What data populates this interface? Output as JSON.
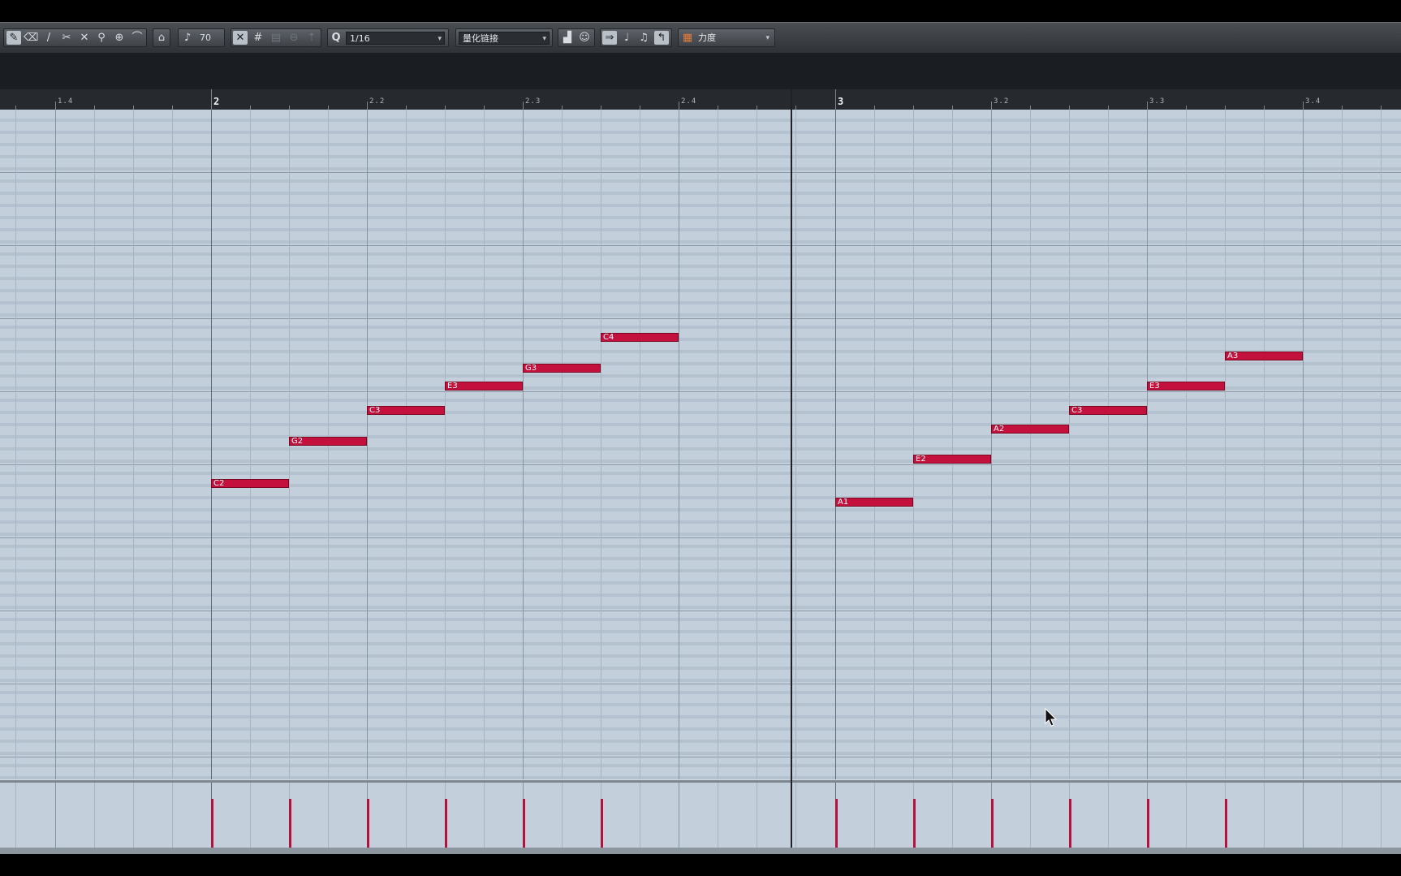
{
  "toolbar": {
    "tools": [
      {
        "name": "pencil-tool",
        "glyph": "✎"
      },
      {
        "name": "eraser-tool",
        "glyph": "⌫"
      },
      {
        "name": "brush-tool",
        "glyph": "/"
      },
      {
        "name": "split-tool",
        "glyph": "✂"
      },
      {
        "name": "mute-tool",
        "glyph": "✕"
      },
      {
        "name": "glue-tool",
        "glyph": "⚲"
      },
      {
        "name": "zoom-tool",
        "glyph": "⊕"
      },
      {
        "name": "line-tool",
        "glyph": "⌒"
      }
    ],
    "velocity_value": "70",
    "quantize_label": "Q",
    "quantize_value": "1/16",
    "quantize_link": "量化链接",
    "controller_lane": "力度"
  },
  "ruler": {
    "labels": [
      {
        "text": "1.4",
        "type": "beat"
      },
      {
        "text": "2",
        "type": "bar"
      },
      {
        "text": "2.2",
        "type": "beat"
      },
      {
        "text": "2.3",
        "type": "beat"
      },
      {
        "text": "2.4",
        "type": "beat"
      },
      {
        "text": "3",
        "type": "bar"
      },
      {
        "text": "3.2",
        "type": "beat"
      },
      {
        "text": "3.3",
        "type": "beat"
      },
      {
        "text": "3.4",
        "type": "beat"
      }
    ]
  },
  "notes": [
    {
      "pitch": "C2",
      "start": "2.1.1",
      "length": "1/16"
    },
    {
      "pitch": "G2",
      "start": "2.1.3",
      "length": "1/16"
    },
    {
      "pitch": "C3",
      "start": "2.2.1",
      "length": "1/16"
    },
    {
      "pitch": "E3",
      "start": "2.2.3",
      "length": "1/16"
    },
    {
      "pitch": "G3",
      "start": "2.3.1",
      "length": "1/16"
    },
    {
      "pitch": "C4",
      "start": "2.3.3",
      "length": "1/16"
    },
    {
      "pitch": "A1",
      "start": "3.1.1",
      "length": "1/16"
    },
    {
      "pitch": "E2",
      "start": "3.1.3",
      "length": "1/16"
    },
    {
      "pitch": "A2",
      "start": "3.2.1",
      "length": "1/16"
    },
    {
      "pitch": "C3",
      "start": "3.2.3",
      "length": "1/16"
    },
    {
      "pitch": "E3",
      "start": "3.3.1",
      "length": "1/16"
    },
    {
      "pitch": "A3",
      "start": "3.3.3",
      "length": "1/16"
    }
  ],
  "colors": {
    "note": "#c4103d",
    "grid": "#c3cfdb",
    "toolbar": "#3f4348"
  }
}
